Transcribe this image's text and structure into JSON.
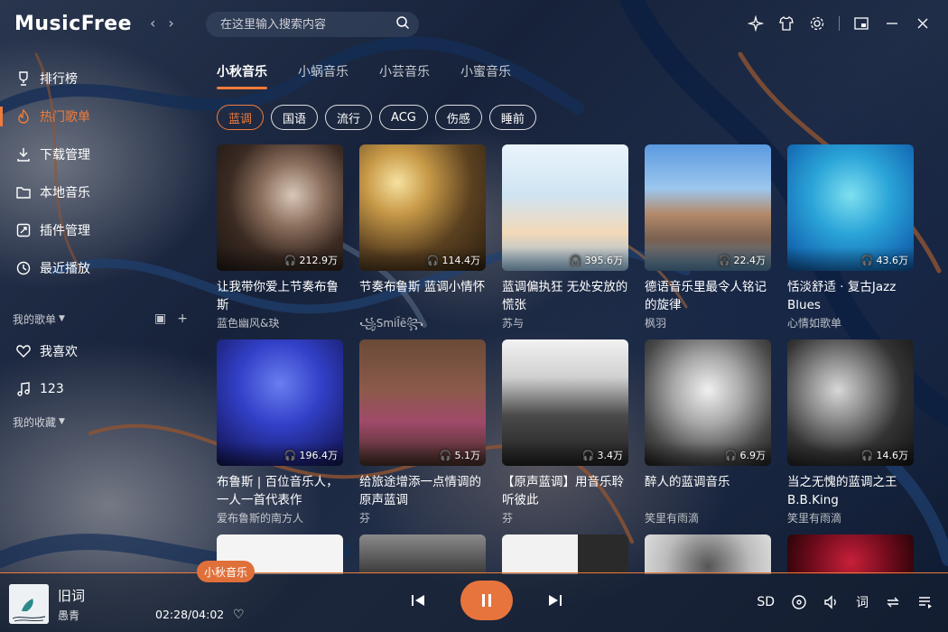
{
  "app": {
    "title": "MusicFree"
  },
  "search": {
    "placeholder": "在这里输入搜索内容"
  },
  "sidebar": {
    "items": [
      {
        "label": "排行榜",
        "icon": "trophy-icon"
      },
      {
        "label": "热门歌单",
        "icon": "fire-icon",
        "active": true
      },
      {
        "label": "下载管理",
        "icon": "download-icon"
      },
      {
        "label": "本地音乐",
        "icon": "folder-icon"
      },
      {
        "label": "插件管理",
        "icon": "plugin-icon"
      },
      {
        "label": "最近播放",
        "icon": "history-icon"
      }
    ],
    "my_playlists_label": "我的歌单",
    "playlists": [
      {
        "label": "我喜欢",
        "icon": "heart-icon"
      },
      {
        "label": "123",
        "icon": "music-note-icon"
      }
    ],
    "my_collections_label": "我的收藏"
  },
  "tabs": [
    "小秋音乐",
    "小蜗音乐",
    "小芸音乐",
    "小蜜音乐"
  ],
  "tags": [
    "蓝调",
    "国语",
    "流行",
    "ACG",
    "伤感",
    "睡前"
  ],
  "cards": [
    {
      "title": "让我带你爱上节奏布鲁斯",
      "author": "蓝色幽风&玦",
      "plays": "212.9万"
    },
    {
      "title": "节奏布鲁斯 蓝调小情怀",
      "author": "꧁SmiĪē꧂",
      "plays": "114.4万"
    },
    {
      "title": "蓝调偏执狂 无处安放的慌张",
      "author": "苏与",
      "plays": "395.6万"
    },
    {
      "title": "德语音乐里最令人铭记的旋律",
      "author": "枫羽",
      "plays": "22.4万"
    },
    {
      "title": "恬淡舒适 · 复古Jazz Blues",
      "author": "心情如歌单",
      "plays": "43.6万"
    },
    {
      "title": "布鲁斯 | 百位音乐人，一人一首代表作",
      "author": "爱布鲁斯的南方人",
      "plays": "196.4万"
    },
    {
      "title": "给旅途增添一点情调的原声蓝调",
      "author": "芬",
      "plays": "5.1万"
    },
    {
      "title": "【原声蓝调】用音乐聆听彼此",
      "author": "芬",
      "plays": "3.4万"
    },
    {
      "title": "醉人的蓝调音乐",
      "author": "笑里有雨滴",
      "plays": "6.9万"
    },
    {
      "title": "当之无愧的蓝调之王B.B.King",
      "author": "笑里有雨滴",
      "plays": "14.6万"
    }
  ],
  "player": {
    "song": "旧词",
    "artist": "愚青",
    "time": "02:28/04:02",
    "source": "小秋音乐",
    "quality": "SD",
    "lyrics_label": "词"
  },
  "colors": {
    "accent": "#f07b3a"
  }
}
